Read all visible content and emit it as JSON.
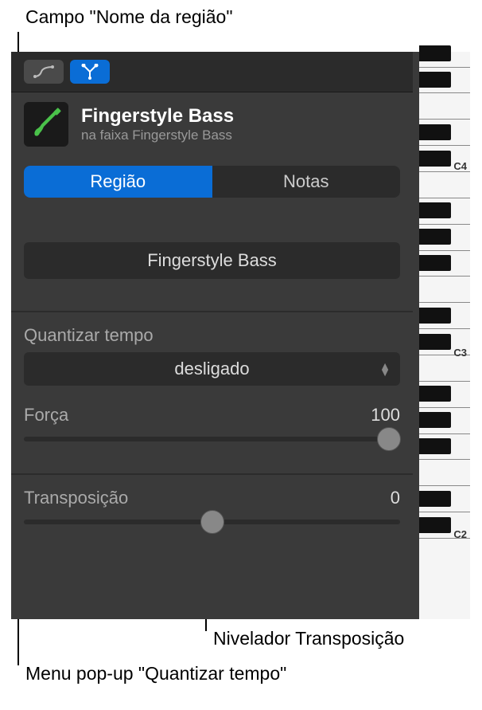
{
  "callouts": {
    "top": "Campo \"Nome da região\"",
    "bottomRight": "Nivelador Transposição",
    "bottomLeft": "Menu pop-up \"Quantizar tempo\""
  },
  "header": {
    "title": "Fingerstyle Bass",
    "subtitle": "na faixa Fingerstyle Bass"
  },
  "tabs": {
    "region": "Região",
    "notes": "Notas"
  },
  "regionName": "Fingerstyle Bass",
  "quantize": {
    "label": "Quantizar tempo",
    "value": "desligado"
  },
  "strength": {
    "label": "Força",
    "value": "100",
    "position": 97
  },
  "transpose": {
    "label": "Transposição",
    "value": "0",
    "position": 50
  },
  "pianoLabels": {
    "c4": "C4",
    "c3": "C3",
    "c2": "C2"
  }
}
